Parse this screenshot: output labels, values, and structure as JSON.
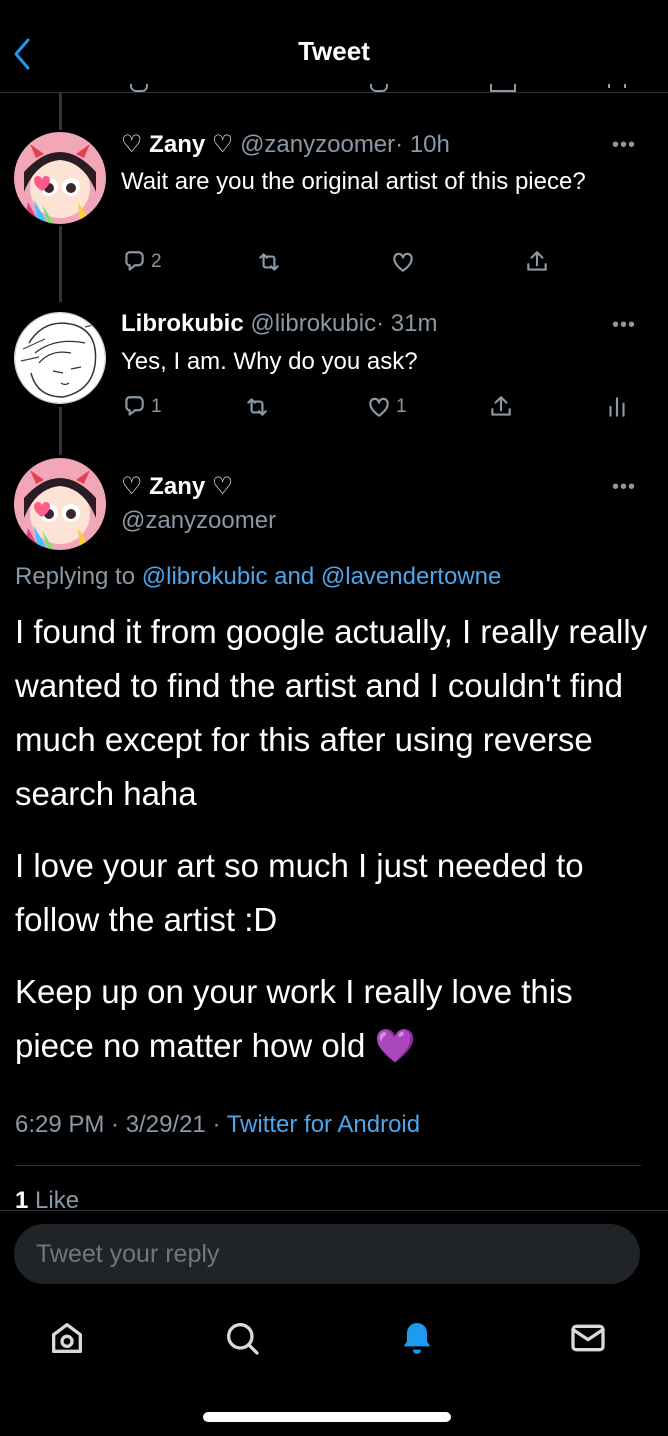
{
  "header": {
    "title": "Tweet"
  },
  "tweets": [
    {
      "name": "♡ Zany ♡",
      "handle": "@zanyzoomer",
      "time": "· 10h",
      "text": "Wait are you the original artist of this piece?",
      "reply_count": "2",
      "retweet_count": "",
      "like_count": ""
    },
    {
      "name": "Librokubic",
      "handle": "@librokubic",
      "time": "· 31m",
      "text": "Yes, I am. Why do you ask?",
      "reply_count": "1",
      "retweet_count": "",
      "like_count": "1"
    }
  ],
  "main_tweet": {
    "name": "♡ Zany ♡",
    "handle": "@zanyzoomer",
    "replying_prefix": "Replying to",
    "replying_to": "@librokubic and @lavendertowne",
    "paragraphs": [
      "I found it from google actually, I really really wanted to find the artist and I couldn't find much except for this after using reverse search haha",
      "I love your art so much I just needed to follow the artist :D",
      "Keep up on your work I really love this piece no matter how old"
    ],
    "emoji": "💜",
    "timestamp": "6:29 PM · 3/29/21 ·",
    "source": "Twitter for Android",
    "likes_count": "1",
    "likes_label": "Like"
  },
  "reply_bar": {
    "placeholder": "Tweet your reply"
  },
  "more_label": "•••",
  "colors": {
    "accent": "#1d9bf0",
    "background": "#000000",
    "secondary_text": "#8b98a5"
  },
  "icons": [
    "back-icon",
    "reply-icon",
    "retweet-icon",
    "like-icon",
    "share-icon",
    "analytics-icon",
    "home-icon",
    "search-icon",
    "notifications-icon",
    "messages-icon"
  ]
}
